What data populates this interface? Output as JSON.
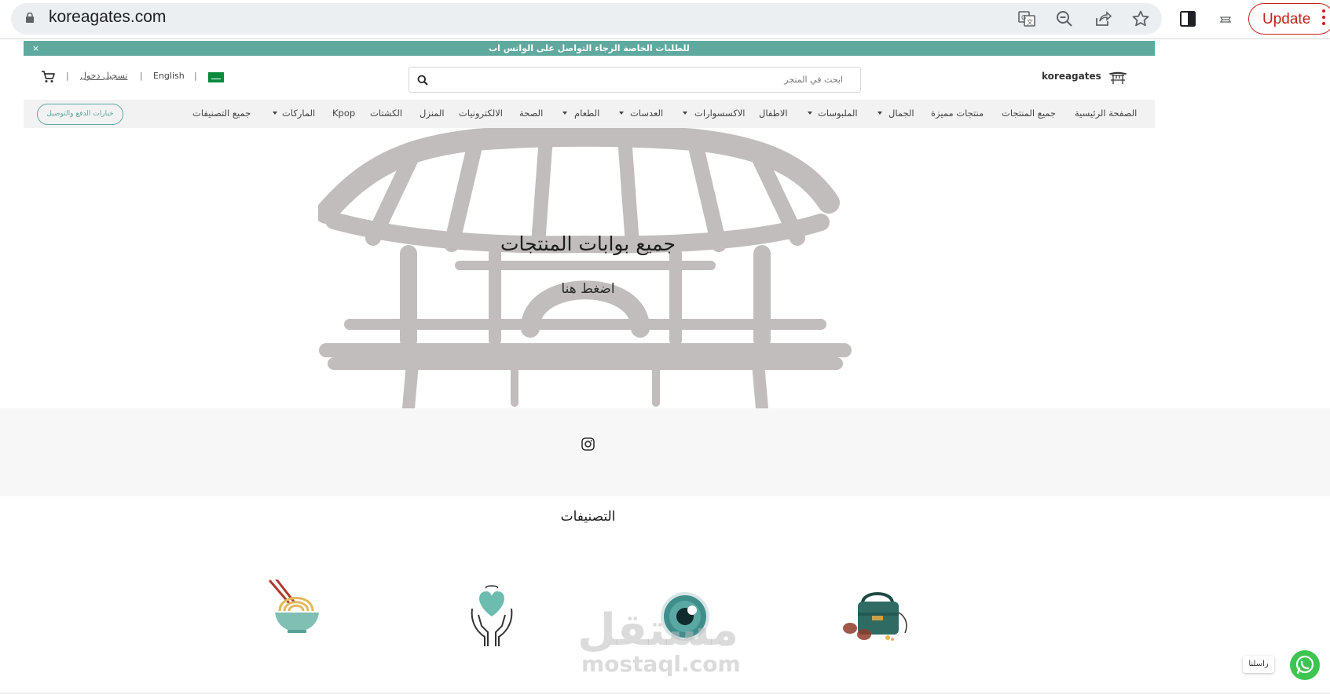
{
  "browser": {
    "url": "koreagates.com",
    "update_label": "Update"
  },
  "site": {
    "notice": "للطلبات الخاصة الرجاء التواصل على الواتس اب",
    "notice_close": "×",
    "login": "تسجيل دخول",
    "separator": "|",
    "language": "English",
    "search_placeholder": "ابحث في المتجر",
    "brand": "koreagates",
    "support_button": "خيارات الدفع والتوصيل",
    "nav": [
      "الصفحة الرئيسية",
      "جميع المنتجات",
      "منتجات مميزة",
      "الجمال",
      "الملبوسات",
      "الاطفال",
      "الاكسسوارات",
      "العدسات",
      "الطعام",
      "الصحة",
      "الالكترونيات",
      "المنزل",
      "الكشتات",
      "Kpop",
      "الماركات",
      "جميع التصنيفات"
    ],
    "hero_title": "جميع بوابات المنتجات",
    "hero_sub": "اضغط هنا",
    "categories_title": "التصنيفات",
    "watermark_ar": "مستقل",
    "watermark_en": "mostaql.com",
    "whatsapp_label": "راسلنا"
  },
  "colors": {
    "accent": "#5fa99e",
    "update": "#c5221f",
    "whatsapp": "#3dc451"
  }
}
